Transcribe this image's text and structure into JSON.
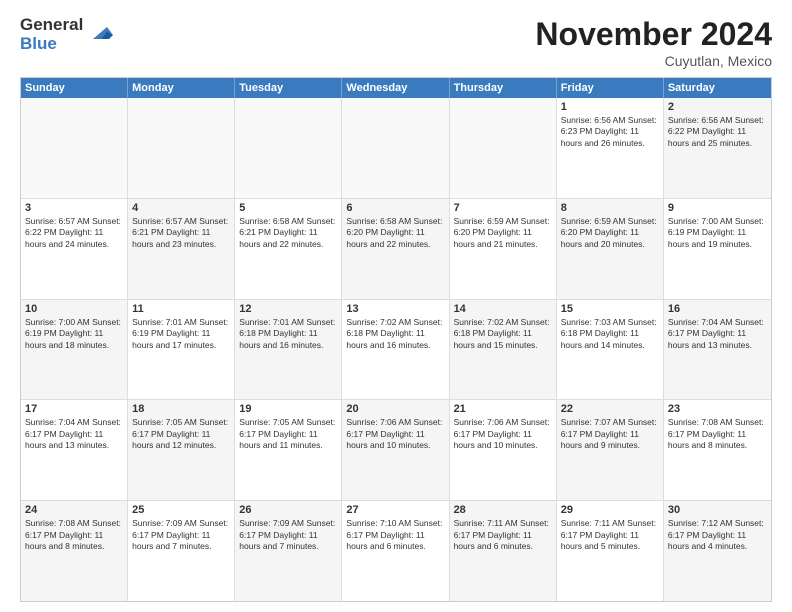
{
  "logo": {
    "general": "General",
    "blue": "Blue"
  },
  "header": {
    "month": "November 2024",
    "location": "Cuyutlan, Mexico"
  },
  "weekdays": [
    "Sunday",
    "Monday",
    "Tuesday",
    "Wednesday",
    "Thursday",
    "Friday",
    "Saturday"
  ],
  "rows": [
    [
      {
        "day": "",
        "empty": true
      },
      {
        "day": "",
        "empty": true
      },
      {
        "day": "",
        "empty": true
      },
      {
        "day": "",
        "empty": true
      },
      {
        "day": "",
        "empty": true
      },
      {
        "day": "1",
        "info": "Sunrise: 6:56 AM\nSunset: 6:23 PM\nDaylight: 11 hours and 26 minutes."
      },
      {
        "day": "2",
        "info": "Sunrise: 6:56 AM\nSunset: 6:22 PM\nDaylight: 11 hours and 25 minutes.",
        "shaded": true
      }
    ],
    [
      {
        "day": "3",
        "info": "Sunrise: 6:57 AM\nSunset: 6:22 PM\nDaylight: 11 hours and 24 minutes."
      },
      {
        "day": "4",
        "info": "Sunrise: 6:57 AM\nSunset: 6:21 PM\nDaylight: 11 hours and 23 minutes.",
        "shaded": true
      },
      {
        "day": "5",
        "info": "Sunrise: 6:58 AM\nSunset: 6:21 PM\nDaylight: 11 hours and 22 minutes."
      },
      {
        "day": "6",
        "info": "Sunrise: 6:58 AM\nSunset: 6:20 PM\nDaylight: 11 hours and 22 minutes.",
        "shaded": true
      },
      {
        "day": "7",
        "info": "Sunrise: 6:59 AM\nSunset: 6:20 PM\nDaylight: 11 hours and 21 minutes."
      },
      {
        "day": "8",
        "info": "Sunrise: 6:59 AM\nSunset: 6:20 PM\nDaylight: 11 hours and 20 minutes.",
        "shaded": true
      },
      {
        "day": "9",
        "info": "Sunrise: 7:00 AM\nSunset: 6:19 PM\nDaylight: 11 hours and 19 minutes."
      }
    ],
    [
      {
        "day": "10",
        "info": "Sunrise: 7:00 AM\nSunset: 6:19 PM\nDaylight: 11 hours and 18 minutes.",
        "shaded": true
      },
      {
        "day": "11",
        "info": "Sunrise: 7:01 AM\nSunset: 6:19 PM\nDaylight: 11 hours and 17 minutes."
      },
      {
        "day": "12",
        "info": "Sunrise: 7:01 AM\nSunset: 6:18 PM\nDaylight: 11 hours and 16 minutes.",
        "shaded": true
      },
      {
        "day": "13",
        "info": "Sunrise: 7:02 AM\nSunset: 6:18 PM\nDaylight: 11 hours and 16 minutes."
      },
      {
        "day": "14",
        "info": "Sunrise: 7:02 AM\nSunset: 6:18 PM\nDaylight: 11 hours and 15 minutes.",
        "shaded": true
      },
      {
        "day": "15",
        "info": "Sunrise: 7:03 AM\nSunset: 6:18 PM\nDaylight: 11 hours and 14 minutes."
      },
      {
        "day": "16",
        "info": "Sunrise: 7:04 AM\nSunset: 6:17 PM\nDaylight: 11 hours and 13 minutes.",
        "shaded": true
      }
    ],
    [
      {
        "day": "17",
        "info": "Sunrise: 7:04 AM\nSunset: 6:17 PM\nDaylight: 11 hours and 13 minutes."
      },
      {
        "day": "18",
        "info": "Sunrise: 7:05 AM\nSunset: 6:17 PM\nDaylight: 11 hours and 12 minutes.",
        "shaded": true
      },
      {
        "day": "19",
        "info": "Sunrise: 7:05 AM\nSunset: 6:17 PM\nDaylight: 11 hours and 11 minutes."
      },
      {
        "day": "20",
        "info": "Sunrise: 7:06 AM\nSunset: 6:17 PM\nDaylight: 11 hours and 10 minutes.",
        "shaded": true
      },
      {
        "day": "21",
        "info": "Sunrise: 7:06 AM\nSunset: 6:17 PM\nDaylight: 11 hours and 10 minutes."
      },
      {
        "day": "22",
        "info": "Sunrise: 7:07 AM\nSunset: 6:17 PM\nDaylight: 11 hours and 9 minutes.",
        "shaded": true
      },
      {
        "day": "23",
        "info": "Sunrise: 7:08 AM\nSunset: 6:17 PM\nDaylight: 11 hours and 8 minutes."
      }
    ],
    [
      {
        "day": "24",
        "info": "Sunrise: 7:08 AM\nSunset: 6:17 PM\nDaylight: 11 hours and 8 minutes.",
        "shaded": true
      },
      {
        "day": "25",
        "info": "Sunrise: 7:09 AM\nSunset: 6:17 PM\nDaylight: 11 hours and 7 minutes."
      },
      {
        "day": "26",
        "info": "Sunrise: 7:09 AM\nSunset: 6:17 PM\nDaylight: 11 hours and 7 minutes.",
        "shaded": true
      },
      {
        "day": "27",
        "info": "Sunrise: 7:10 AM\nSunset: 6:17 PM\nDaylight: 11 hours and 6 minutes."
      },
      {
        "day": "28",
        "info": "Sunrise: 7:11 AM\nSunset: 6:17 PM\nDaylight: 11 hours and 6 minutes.",
        "shaded": true
      },
      {
        "day": "29",
        "info": "Sunrise: 7:11 AM\nSunset: 6:17 PM\nDaylight: 11 hours and 5 minutes."
      },
      {
        "day": "30",
        "info": "Sunrise: 7:12 AM\nSunset: 6:17 PM\nDaylight: 11 hours and 4 minutes.",
        "shaded": true
      }
    ]
  ]
}
